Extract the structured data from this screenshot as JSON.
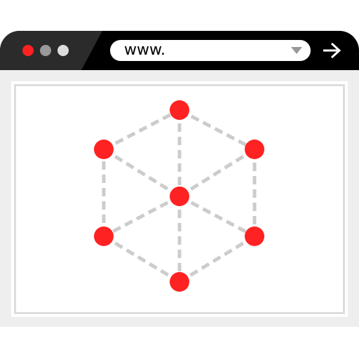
{
  "browser": {
    "title_bar_color": "#000000",
    "title_bar_accent_color": "#2b2b2b",
    "window_controls": [
      {
        "name": "close-dot",
        "color": "#ff2222"
      },
      {
        "name": "minimize-dot",
        "color": "#999999"
      },
      {
        "name": "maximize-dot",
        "color": "#dddddd"
      }
    ],
    "address_bar": {
      "url": "www.",
      "dropdown_icon": "chevron-down-icon"
    },
    "go_icon": "arrow-right-icon",
    "page_background": "#eeeeee"
  },
  "graphic": {
    "node_color": "#ff2222",
    "edge_color": "#cccccc",
    "edge_style": "dashed",
    "icon": "network-cube-icon"
  }
}
